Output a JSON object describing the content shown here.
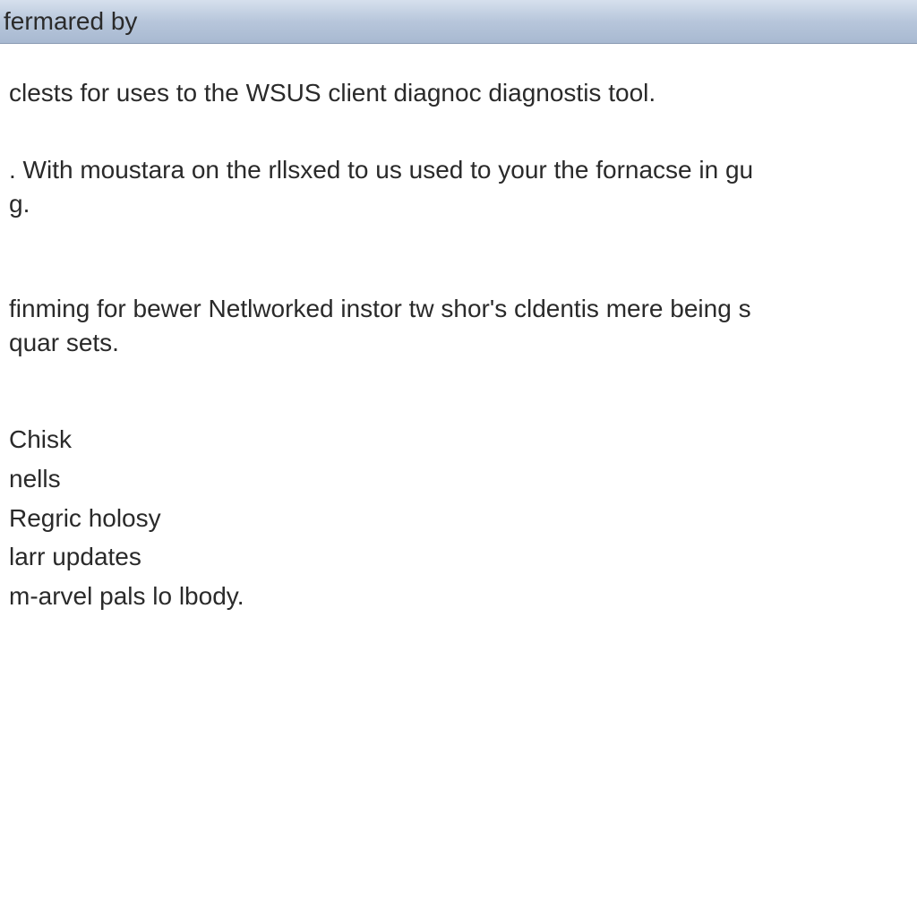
{
  "titlebar": {
    "text": "fermared by"
  },
  "body": {
    "p1": "clests for uses to the WSUS client diagnoc diagnostis tool.",
    "p2_line1": ". With moustara on the rllsxed to us used to your the fornacse in gu",
    "p2_line2": "g.",
    "p3_line1": "finming for bewer Netlworked instor tw shor's cldentis mere being s",
    "p3_line2": "quar sets.",
    "list": [
      "Chisk",
      "nells",
      "Regric holosy",
      "larr updates",
      "m-arvel pals lo lbody."
    ]
  }
}
